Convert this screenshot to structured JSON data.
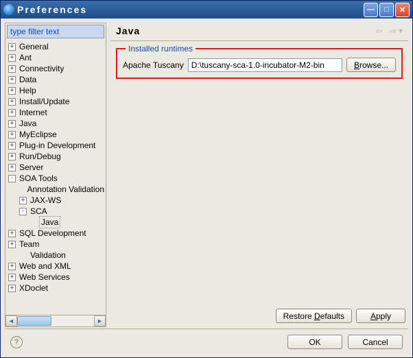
{
  "window": {
    "title": "Preferences"
  },
  "filter": {
    "value": "type filter text"
  },
  "tree": {
    "items": [
      {
        "label": "General",
        "exp": "+",
        "indent": 0
      },
      {
        "label": "Ant",
        "exp": "+",
        "indent": 0
      },
      {
        "label": "Connectivity",
        "exp": "+",
        "indent": 0
      },
      {
        "label": "Data",
        "exp": "+",
        "indent": 0
      },
      {
        "label": "Help",
        "exp": "+",
        "indent": 0
      },
      {
        "label": "Install/Update",
        "exp": "+",
        "indent": 0
      },
      {
        "label": "Internet",
        "exp": "+",
        "indent": 0
      },
      {
        "label": "Java",
        "exp": "+",
        "indent": 0
      },
      {
        "label": "MyEclipse",
        "exp": "+",
        "indent": 0
      },
      {
        "label": "Plug-in Development",
        "exp": "+",
        "indent": 0
      },
      {
        "label": "Run/Debug",
        "exp": "+",
        "indent": 0
      },
      {
        "label": "Server",
        "exp": "+",
        "indent": 0
      },
      {
        "label": "SOA Tools",
        "exp": "-",
        "indent": 0
      },
      {
        "label": "Annotation Validation",
        "exp": "",
        "indent": 1
      },
      {
        "label": "JAX-WS",
        "exp": "+",
        "indent": 1
      },
      {
        "label": "SCA",
        "exp": "-",
        "indent": 1
      },
      {
        "label": "Java",
        "exp": "",
        "indent": 2,
        "selected": true
      },
      {
        "label": "SQL Development",
        "exp": "+",
        "indent": 0
      },
      {
        "label": "Team",
        "exp": "+",
        "indent": 0
      },
      {
        "label": "Validation",
        "exp": "",
        "indent": 1
      },
      {
        "label": "Web and XML",
        "exp": "+",
        "indent": 0
      },
      {
        "label": "Web Services",
        "exp": "+",
        "indent": 0
      },
      {
        "label": "XDoclet",
        "exp": "+",
        "indent": 0
      }
    ]
  },
  "page": {
    "title": "Java",
    "group_legend": "Installed runtimes",
    "runtime_label": "Apache Tuscany",
    "runtime_path": "D:\\tuscany-sca-1.0-incubator-M2-bin",
    "browse": "Browse...",
    "restore": "Restore Defaults",
    "apply": "Apply"
  },
  "footer": {
    "ok": "OK",
    "cancel": "Cancel"
  }
}
